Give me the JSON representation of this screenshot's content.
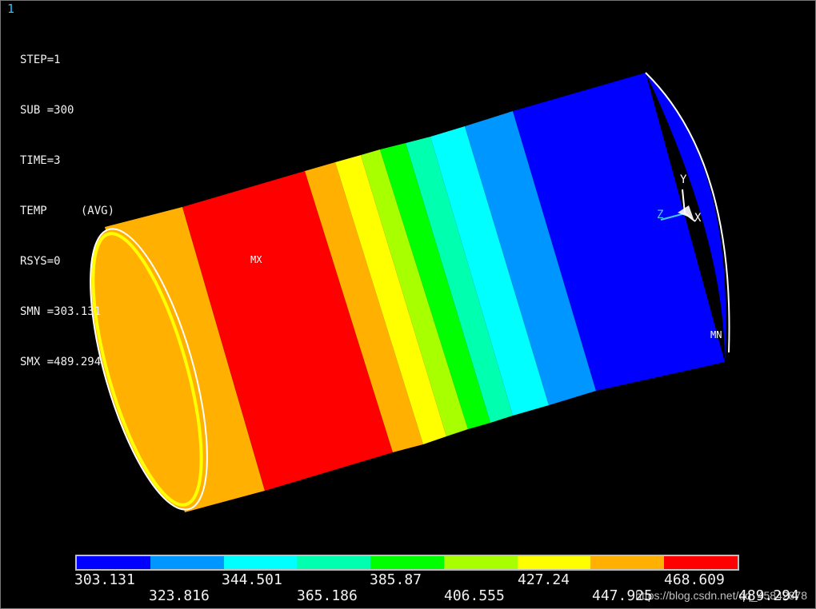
{
  "window": {
    "number": "1"
  },
  "info": {
    "step": "STEP=1",
    "sub": "SUB =300",
    "time": "TIME=3",
    "temp": "TEMP     (AVG)",
    "rsys": "RSYS=0",
    "smn": "SMN =303.131",
    "smx": "SMX =489.294"
  },
  "callouts": {
    "mx": "MX",
    "mn": "MN"
  },
  "triad": {
    "x": "X",
    "y": "Y",
    "z": "Z"
  },
  "legend": {
    "colors": [
      "#0000ff",
      "#0096ff",
      "#00ffff",
      "#00ffae",
      "#00ff00",
      "#a8ff00",
      "#ffff00",
      "#ffb000",
      "#ff0000"
    ],
    "upper_labels": [
      "303.131",
      "344.501",
      "385.87",
      "427.24",
      "468.609"
    ],
    "lower_labels": [
      "323.816",
      "365.186",
      "406.555",
      "447.925",
      "489.294"
    ]
  },
  "watermark": "https://blog.csdn.net/qq_45842878"
}
